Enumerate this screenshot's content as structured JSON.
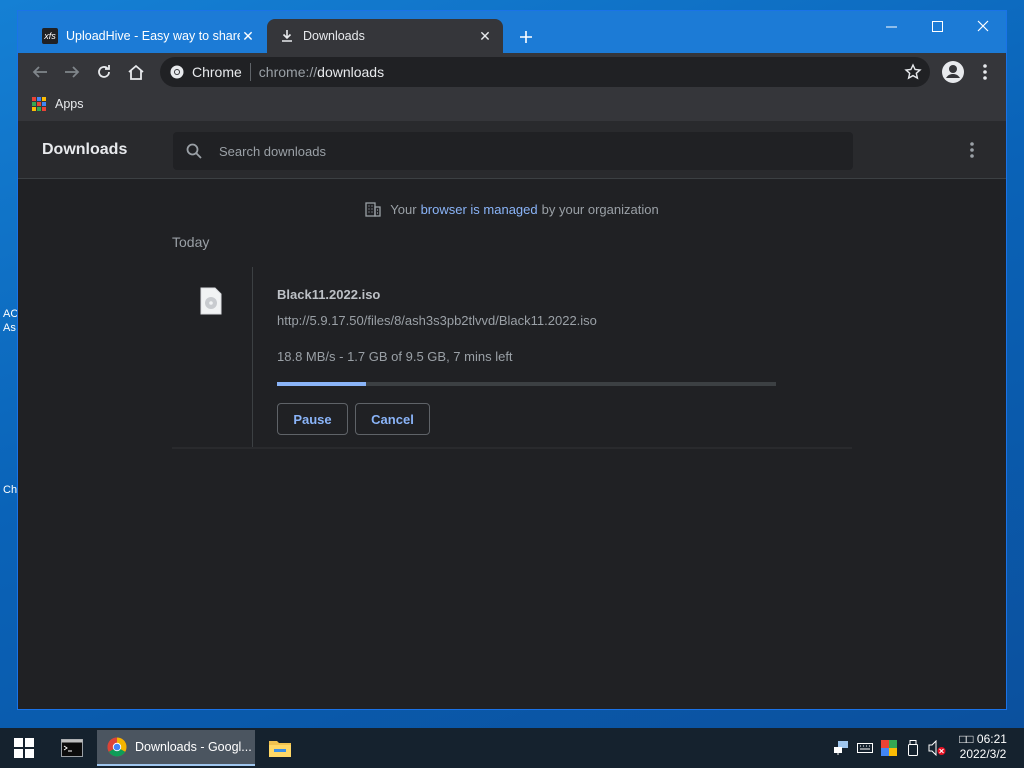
{
  "desktop": {
    "label_ac_line1": "AC",
    "label_ac_line2": "As",
    "label_ch": "Ch"
  },
  "browser": {
    "tabs": [
      {
        "title": "UploadHive - Easy way to share y",
        "favicon": "xfs",
        "active": false
      },
      {
        "title": "Downloads",
        "favicon": "download-icon",
        "active": true
      }
    ],
    "omnibox": {
      "chip_label": "Chrome",
      "url_scheme": "chrome://",
      "url_host": "downloads"
    },
    "bookmarks": {
      "apps_label": "Apps"
    }
  },
  "downloads_page": {
    "title": "Downloads",
    "search_placeholder": "Search downloads",
    "managed_notice": {
      "prefix": "Your",
      "link": "browser is managed",
      "suffix": "by your organization"
    },
    "date_header": "Today",
    "items": [
      {
        "file_name": "Black11.2022.iso",
        "url": "http://5.9.17.50/files/8/ash3s3pb2tlvvd/Black11.2022.iso",
        "status": "18.8 MB/s - 1.7 GB of 9.5 GB, 7 mins left",
        "progress_fraction": 0.179,
        "pause_label": "Pause",
        "cancel_label": "Cancel"
      }
    ]
  },
  "taskbar": {
    "chrome_item_label": "Downloads - Googl...",
    "clock_time": "□□ 06:21",
    "clock_date": "2022/3/2"
  },
  "colors": {
    "accent_link": "#8ab4f8",
    "page_bg": "#202124",
    "toolbar_bg": "#35363a",
    "titlebar_bg": "#1c7bd6"
  }
}
